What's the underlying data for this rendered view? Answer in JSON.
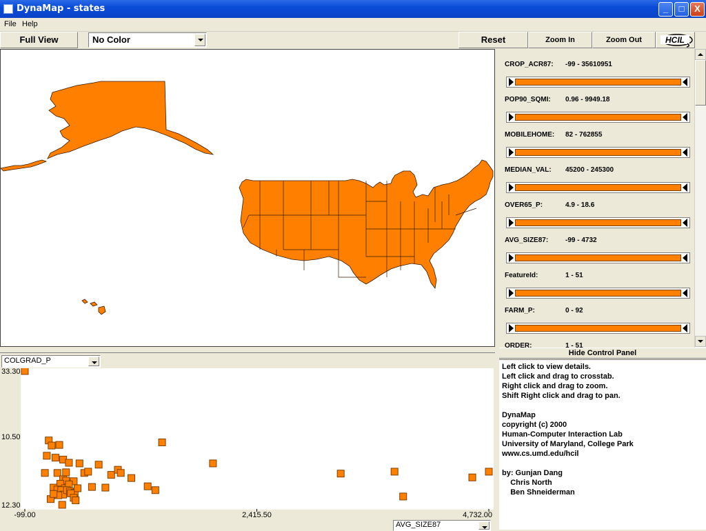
{
  "window": {
    "title": "DynaMap - states",
    "min": "_",
    "max": "□",
    "close": "X"
  },
  "menu": [
    "File",
    "Help"
  ],
  "toolbar": {
    "full_view": "Full View",
    "color_select": "No Color",
    "reset": "Reset",
    "zoom_in": "Zoom In",
    "zoom_out": "Zoom Out",
    "logo": "HCIL"
  },
  "sliders": [
    {
      "name": "CROP_ACR87:",
      "range": "-99 - 35610951"
    },
    {
      "name": "POP90_SQMI:",
      "range": "0.96 - 9949.18"
    },
    {
      "name": "MOBILEHOME:",
      "range": "82 - 762855"
    },
    {
      "name": "MEDIAN_VAL:",
      "range": "45200 - 245300"
    },
    {
      "name": "OVER65_P:",
      "range": "4.9 - 18.6"
    },
    {
      "name": "AVG_SIZE87:",
      "range": "-99 - 4732"
    },
    {
      "name": "FeatureId:",
      "range": "1 - 51"
    },
    {
      "name": "FARM_P:",
      "range": "0 - 92"
    },
    {
      "name": "ORDER:",
      "range": "1 - 51"
    }
  ],
  "hide_panel": "Hide Control Panel",
  "info_lines": [
    "Left click to view details.",
    "Left click and drag to crosstab.",
    "Right click and drag to zoom.",
    "Shift Right click and drag to pan.",
    "",
    "DynaMap",
    "copyright (c) 2000",
    "Human-Computer Interaction Lab",
    "University of Maryland, College Park",
    "www.cs.umd.edu/hcil",
    "",
    "by: Gunjan Dang",
    "    Chris North",
    "    Ben Shneiderman"
  ],
  "colors": {
    "accent": "#FF8000",
    "border": "#804000"
  },
  "scatter": {
    "y_select": "COLGRAD_P",
    "x_select": "AVG_SIZE87"
  },
  "chart_data": {
    "type": "scatter",
    "xlabel": "",
    "ylabel": "",
    "xlim": [
      -99,
      4732
    ],
    "ylim": [
      12.3,
      33.3
    ],
    "x_ticks": [
      "-99.00",
      "2,415.50",
      "4,732.00"
    ],
    "y_ticks": [
      "33.30",
      "10.50",
      "12.30"
    ],
    "points": [
      [
        -99,
        33.3
      ],
      [
        150,
        22.4
      ],
      [
        180,
        21.6
      ],
      [
        260,
        21.7
      ],
      [
        1330,
        22.1
      ],
      [
        130,
        20.0
      ],
      [
        220,
        19.7
      ],
      [
        300,
        19.4
      ],
      [
        360,
        18.9
      ],
      [
        470,
        18.8
      ],
      [
        670,
        18.6
      ],
      [
        1860,
        18.8
      ],
      [
        330,
        17.4
      ],
      [
        520,
        17.3
      ],
      [
        560,
        17.5
      ],
      [
        800,
        17.0
      ],
      [
        870,
        17.8
      ],
      [
        900,
        17.3
      ],
      [
        1010,
        16.5
      ],
      [
        110,
        17.3
      ],
      [
        240,
        17.3
      ],
      [
        300,
        16.3
      ],
      [
        330,
        16.1
      ],
      [
        410,
        16.0
      ],
      [
        270,
        15.6
      ],
      [
        320,
        14.9
      ],
      [
        360,
        15.5
      ],
      [
        200,
        15.0
      ],
      [
        240,
        14.7
      ],
      [
        280,
        14.6
      ],
      [
        300,
        13.9
      ],
      [
        340,
        14.6
      ],
      [
        370,
        14.4
      ],
      [
        420,
        14.2
      ],
      [
        450,
        14.9
      ],
      [
        600,
        15.1
      ],
      [
        740,
        15.0
      ],
      [
        1180,
        15.2
      ],
      [
        1260,
        14.6
      ],
      [
        250,
        13.8
      ],
      [
        380,
        14.1
      ],
      [
        410,
        13.4
      ],
      [
        170,
        13.2
      ],
      [
        290,
        12.3
      ],
      [
        430,
        13.0
      ],
      [
        3190,
        17.2
      ],
      [
        3750,
        17.5
      ],
      [
        4560,
        16.6
      ],
      [
        4732,
        17.5
      ],
      [
        3840,
        13.6
      ],
      [
        200,
        14.0
      ]
    ]
  }
}
